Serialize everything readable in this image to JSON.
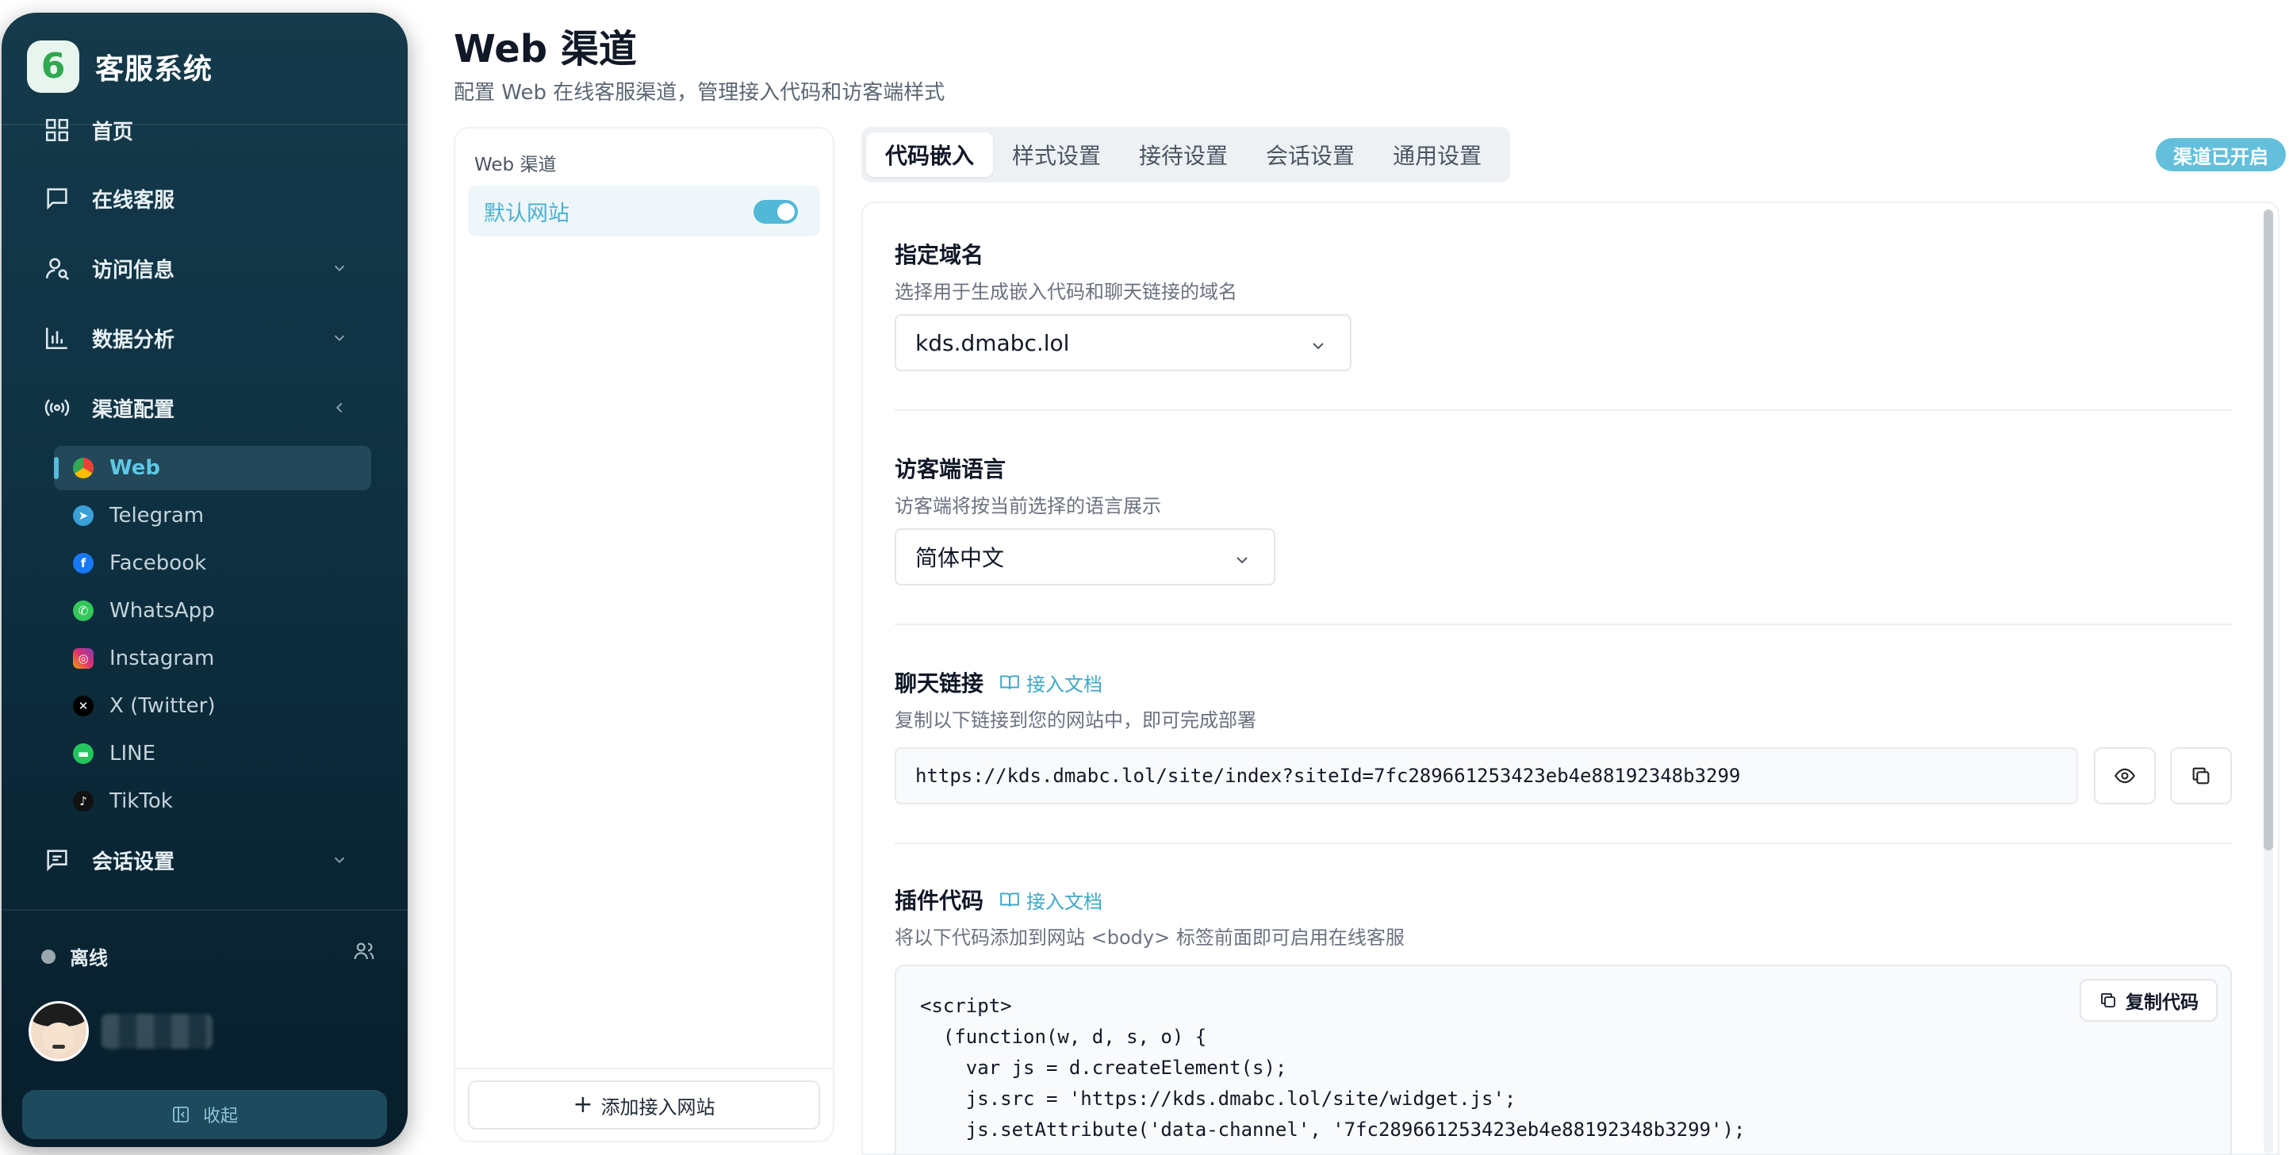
{
  "brand": {
    "name": "客服系统",
    "logo_glyph": "6",
    "logo_color": "#2fa84f"
  },
  "nav": {
    "items": [
      {
        "key": "home",
        "label": "首页",
        "icon": "grid-icon"
      },
      {
        "key": "online",
        "label": "在线客服",
        "icon": "chat-icon"
      },
      {
        "key": "visitor",
        "label": "访问信息",
        "icon": "user-search-icon"
      },
      {
        "key": "analytics",
        "label": "数据分析",
        "icon": "bar-chart-icon"
      },
      {
        "key": "channels",
        "label": "渠道配置",
        "icon": "broadcast-icon"
      },
      {
        "key": "session",
        "label": "会话设置",
        "icon": "message-lines-icon"
      }
    ],
    "channels": [
      {
        "label": "Web",
        "icon": "chrome-icon",
        "color": "#e8453c",
        "active": true
      },
      {
        "label": "Telegram",
        "icon": "telegram-icon",
        "color": "#3a9fd9"
      },
      {
        "label": "Facebook",
        "icon": "facebook-icon",
        "color": "#1877f2"
      },
      {
        "label": "WhatsApp",
        "icon": "whatsapp-icon",
        "color": "#34c759"
      },
      {
        "label": "Instagram",
        "icon": "instagram-icon",
        "color": "#d6336c"
      },
      {
        "label": "X (Twitter)",
        "icon": "x-icon",
        "color": "#000000"
      },
      {
        "label": "LINE",
        "icon": "line-icon",
        "color": "#22c55e"
      },
      {
        "label": "TikTok",
        "icon": "tiktok-icon",
        "color": "#111111"
      }
    ]
  },
  "user": {
    "status": "离线"
  },
  "sidebar_footer": {
    "collapse_label": "收起"
  },
  "page": {
    "title": "Web 渠道",
    "subtitle": "配置 Web 在线客服渠道，管理接入代码和访客端样式"
  },
  "sites": {
    "panel_title": "Web 渠道",
    "items": [
      {
        "label": "默认网站",
        "enabled": true
      }
    ],
    "add_label": "添加接入网站"
  },
  "tabs": [
    {
      "label": "代码嵌入",
      "active": true
    },
    {
      "label": "样式设置"
    },
    {
      "label": "接待设置"
    },
    {
      "label": "会话设置"
    },
    {
      "label": "通用设置"
    }
  ],
  "channel_status": "渠道已开启",
  "sections": {
    "domain": {
      "title": "指定域名",
      "desc": "选择用于生成嵌入代码和聊天链接的域名",
      "value": "kds.dmabc.lol"
    },
    "language": {
      "title": "访客端语言",
      "desc": "访客端将按当前选择的语言展示",
      "value": "简体中文"
    },
    "chat_link": {
      "title": "聊天链接",
      "doc_label": "接入文档",
      "desc": "复制以下链接到您的网站中，即可完成部署",
      "url": "https://kds.dmabc.lol/site/index?siteId=7fc289661253423eb4e88192348b3299"
    },
    "plugin_code": {
      "title": "插件代码",
      "doc_label": "接入文档",
      "desc": "将以下代码添加到网站 <body> 标签前面即可启用在线客服",
      "copy_label": "复制代码",
      "lines": [
        "<script>",
        "  (function(w, d, s, o) {",
        "    var js = d.createElement(s);",
        "    js.src = 'https://kds.dmabc.lol/site/widget.js';",
        "    js.setAttribute('data-channel', '7fc289661253423eb4e88192348b3299');"
      ]
    }
  },
  "colors": {
    "accent": "#4ab2d2",
    "badge": "#64bfdc",
    "sidebar_bg": "#0f3243"
  }
}
